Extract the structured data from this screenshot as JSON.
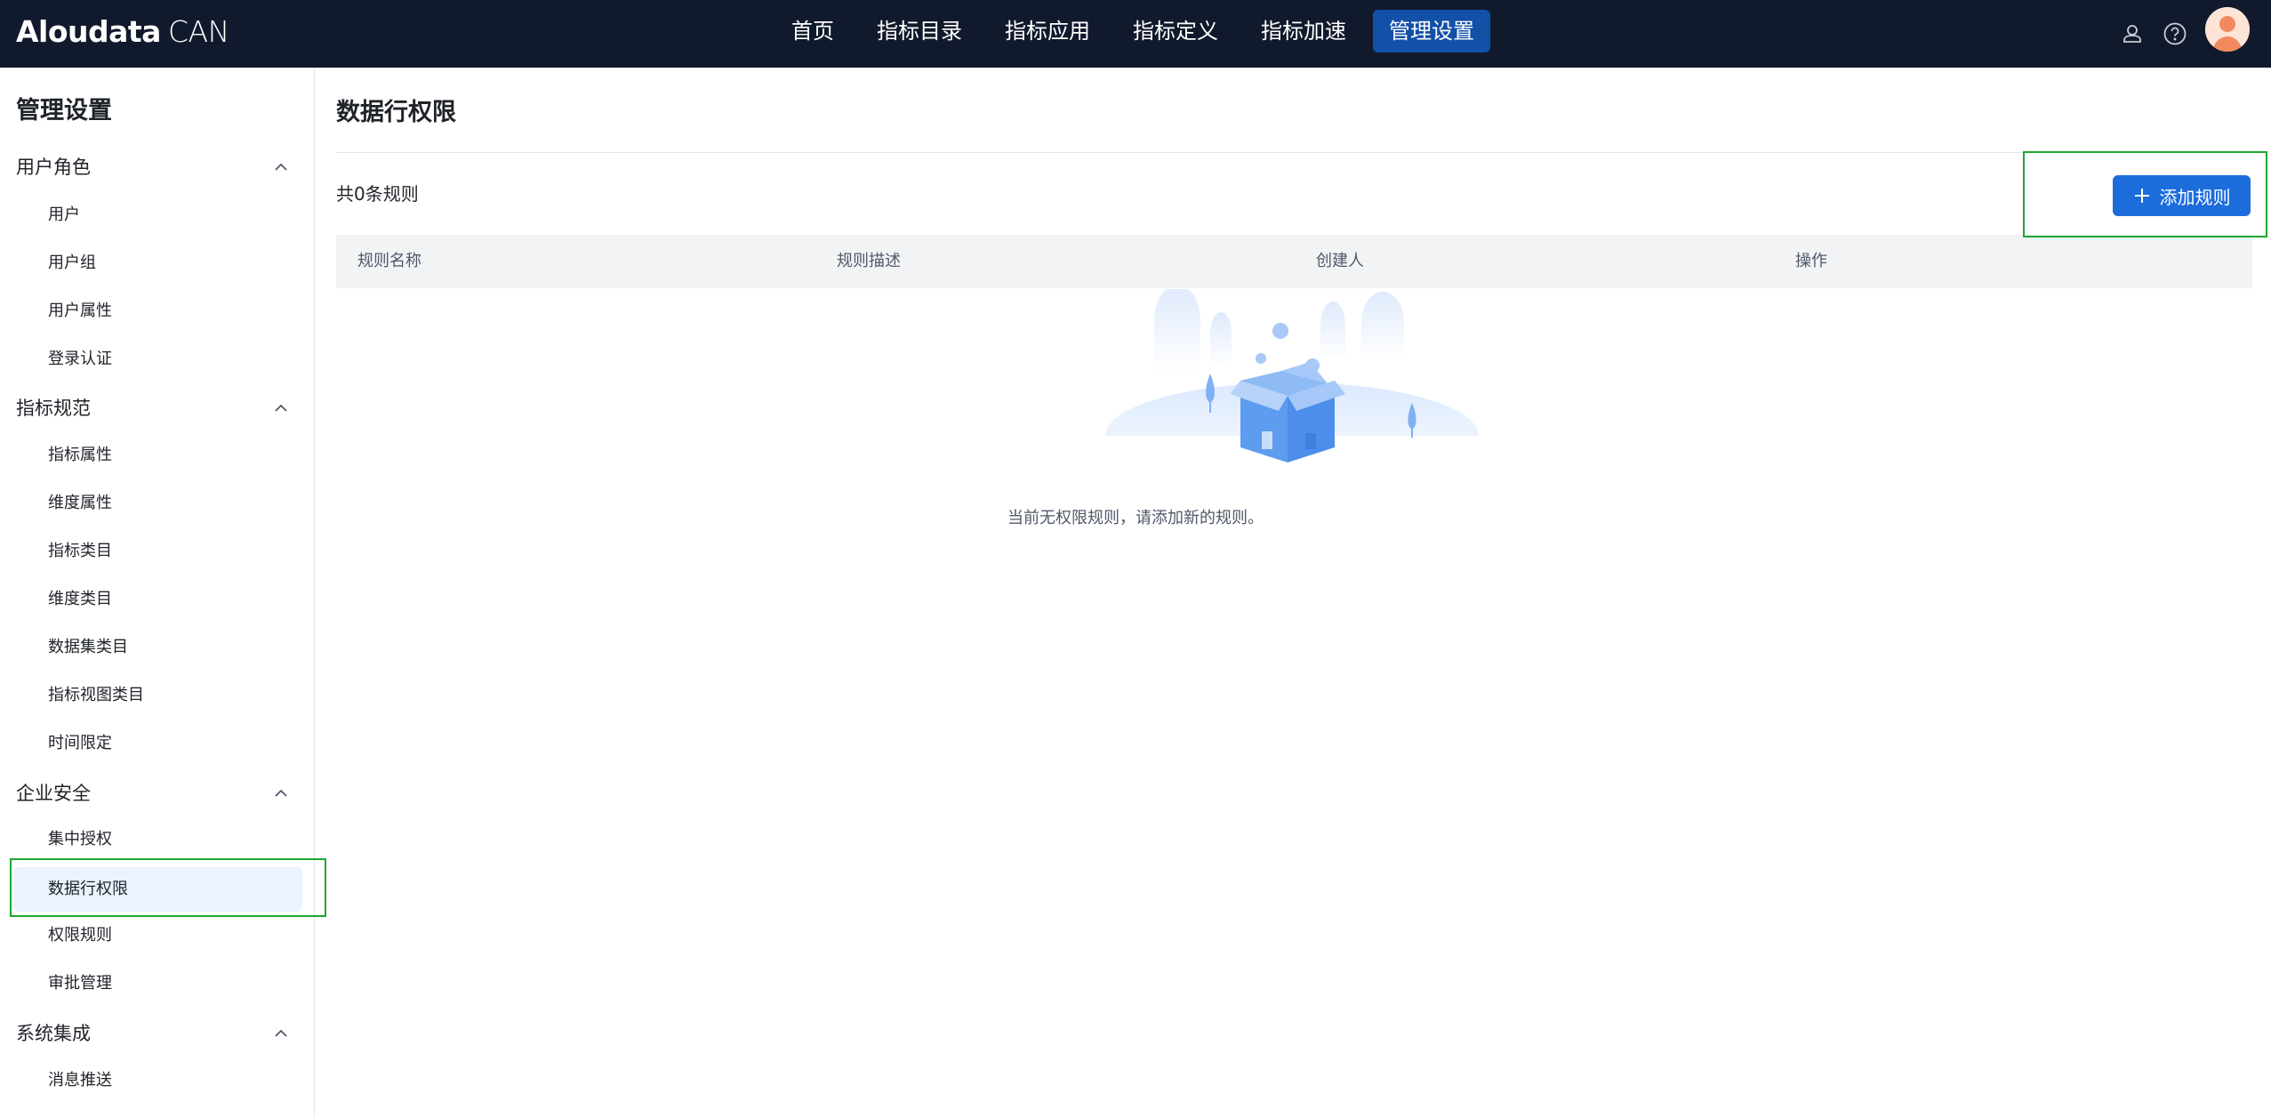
{
  "app": {
    "logo_bold": "Aloudata",
    "logo_light": "CAN"
  },
  "nav": {
    "items": [
      {
        "label": "首页"
      },
      {
        "label": "指标目录"
      },
      {
        "label": "指标应用"
      },
      {
        "label": "指标定义"
      },
      {
        "label": "指标加速"
      },
      {
        "label": "管理设置",
        "active": true
      }
    ]
  },
  "header_icons": [
    "user-upload-icon",
    "help-icon",
    "avatar"
  ],
  "sidebar": {
    "title": "管理设置",
    "groups": [
      {
        "label": "用户角色",
        "expanded": true,
        "items": [
          "用户",
          "用户组",
          "用户属性",
          "登录认证"
        ]
      },
      {
        "label": "指标规范",
        "expanded": true,
        "items": [
          "指标属性",
          "维度属性",
          "指标类目",
          "维度类目",
          "数据集类目",
          "指标视图类目",
          "时间限定"
        ]
      },
      {
        "label": "企业安全",
        "expanded": true,
        "items": [
          "集中授权",
          "数据行权限",
          "权限规则",
          "审批管理"
        ]
      },
      {
        "label": "系统集成",
        "expanded": true,
        "items": [
          "消息推送"
        ]
      }
    ],
    "active_item": "数据行权限"
  },
  "main": {
    "title": "数据行权限",
    "count_text": "共0条规则",
    "add_button_label": "添加规则",
    "table": {
      "columns": [
        "规则名称",
        "规则描述",
        "创建人",
        "操作"
      ],
      "rows": []
    },
    "empty_text": "当前无权限规则，请添加新的规则。"
  },
  "colors": {
    "topbar_bg": "#111a2c",
    "nav_active_bg": "#1350a8",
    "primary": "#1c6cdc",
    "sidebar_active_bg": "#ebf3ff",
    "highlight_border": "#1fa630"
  }
}
